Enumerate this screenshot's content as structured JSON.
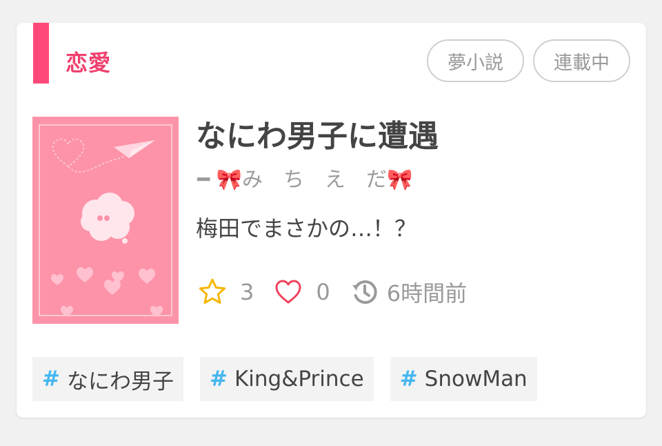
{
  "card": {
    "genre": "恋愛",
    "badges": [
      "夢小説",
      "連載中"
    ],
    "title": "なにわ男子に遭遇",
    "author": "━ 🎀み　ち　え　だ🎀",
    "summary": "梅田でまさかの…！？",
    "stats": {
      "stars": "3",
      "likes": "0",
      "updated": "6時間前"
    },
    "tags": [
      {
        "hash": "#",
        "label": "なにわ男子"
      },
      {
        "hash": "#",
        "label": "King&Prince"
      },
      {
        "hash": "#",
        "label": "SnowMan"
      }
    ]
  },
  "icons": {
    "star": "star-icon",
    "heart": "heart-icon",
    "clock": "history-clock-icon"
  },
  "colors": {
    "accent": "#ff4a79",
    "cover_bg": "#fd93a8",
    "star": "#f7b500",
    "heart": "#f0405a",
    "hash": "#45b6f0"
  }
}
